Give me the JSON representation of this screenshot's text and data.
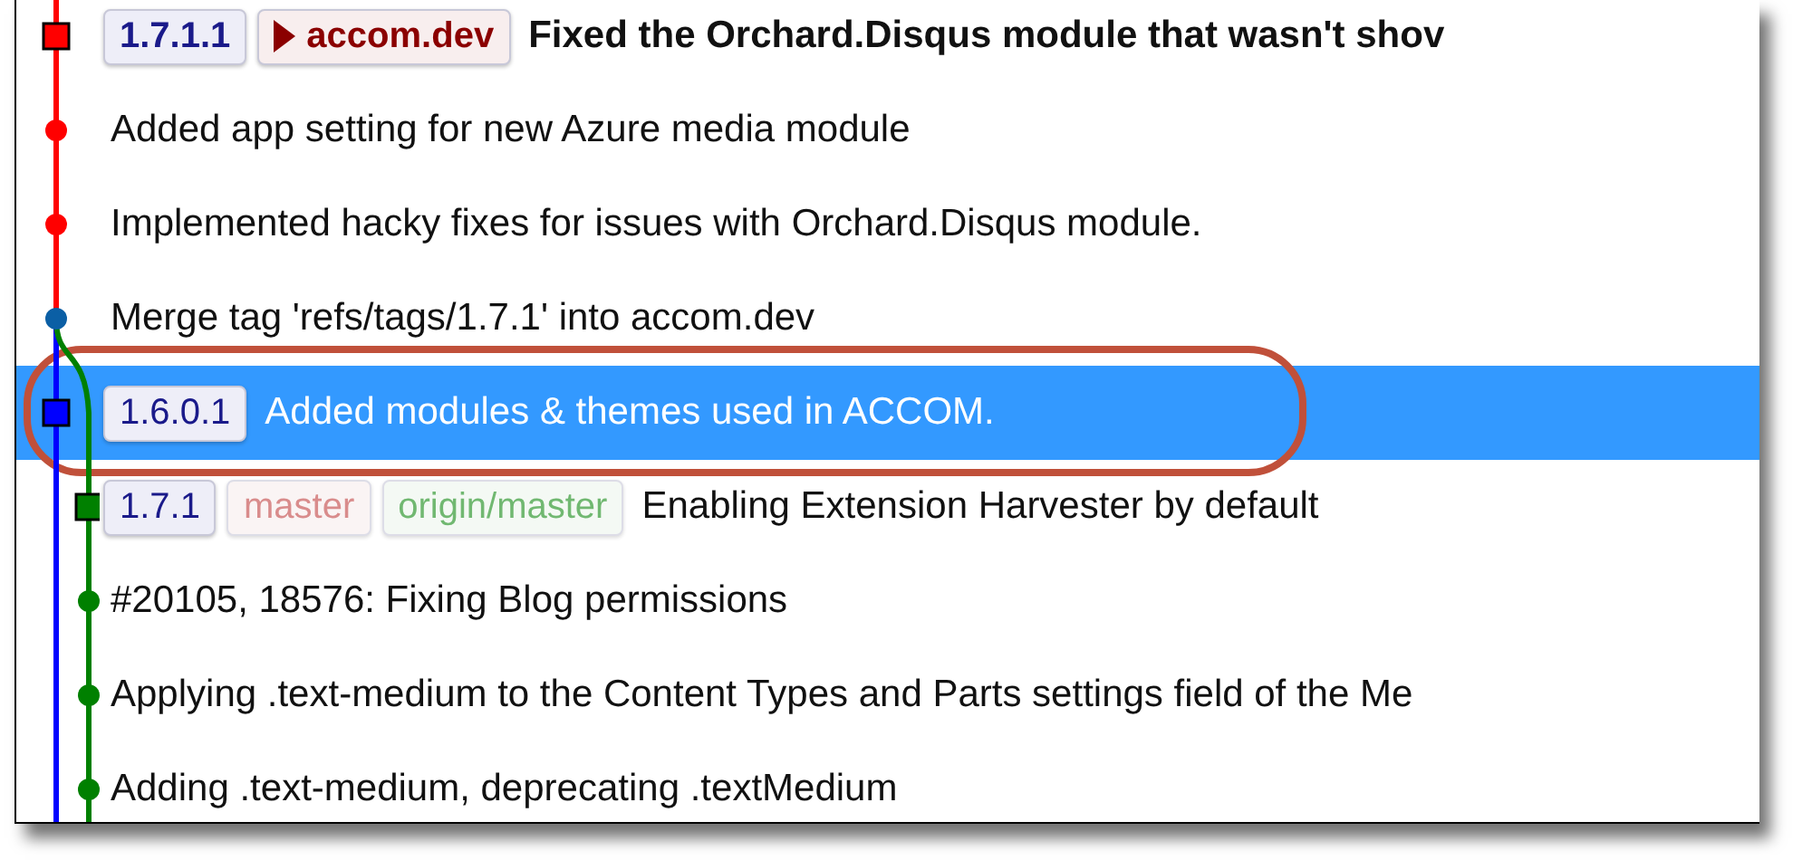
{
  "commits": [
    {
      "refs": [
        {
          "label": "1.7.1.1",
          "kind": "tag"
        },
        {
          "label": "accom.dev",
          "kind": "head"
        }
      ],
      "message": "Fixed the Orchard.Disqus module that wasn't shov",
      "bold": true,
      "selected": false,
      "color": "#ff0000"
    },
    {
      "message": "Added app setting for new Azure media module",
      "bold": false,
      "selected": false,
      "color": "#ff0000"
    },
    {
      "message": "Implemented hacky fixes for issues with Orchard.Disqus module.",
      "bold": false,
      "selected": false,
      "color": "#ff0000"
    },
    {
      "message": "Merge tag 'refs/tags/1.7.1' into accom.dev",
      "bold": false,
      "selected": false,
      "color": "#0b5fa5"
    },
    {
      "refs": [
        {
          "label": "1.6.0.1",
          "kind": "tag"
        }
      ],
      "message": "Added modules & themes used in ACCOM.",
      "bold": false,
      "selected": true,
      "color": "#0000ff"
    },
    {
      "refs": [
        {
          "label": "1.7.1",
          "kind": "tag"
        },
        {
          "label": "master",
          "kind": "branch"
        },
        {
          "label": "origin/master",
          "kind": "remote"
        }
      ],
      "message": "Enabling Extension Harvester by default",
      "bold": false,
      "selected": false,
      "color": "#008000"
    },
    {
      "message": "#20105, 18576: Fixing Blog permissions",
      "bold": false,
      "selected": false,
      "color": "#008000"
    },
    {
      "message": "Applying .text-medium to the Content Types and Parts settings field of the Me",
      "bold": false,
      "selected": false,
      "color": "#008000"
    },
    {
      "message": "Adding .text-medium, deprecating .textMedium",
      "bold": false,
      "selected": false,
      "color": "#008000"
    }
  ]
}
